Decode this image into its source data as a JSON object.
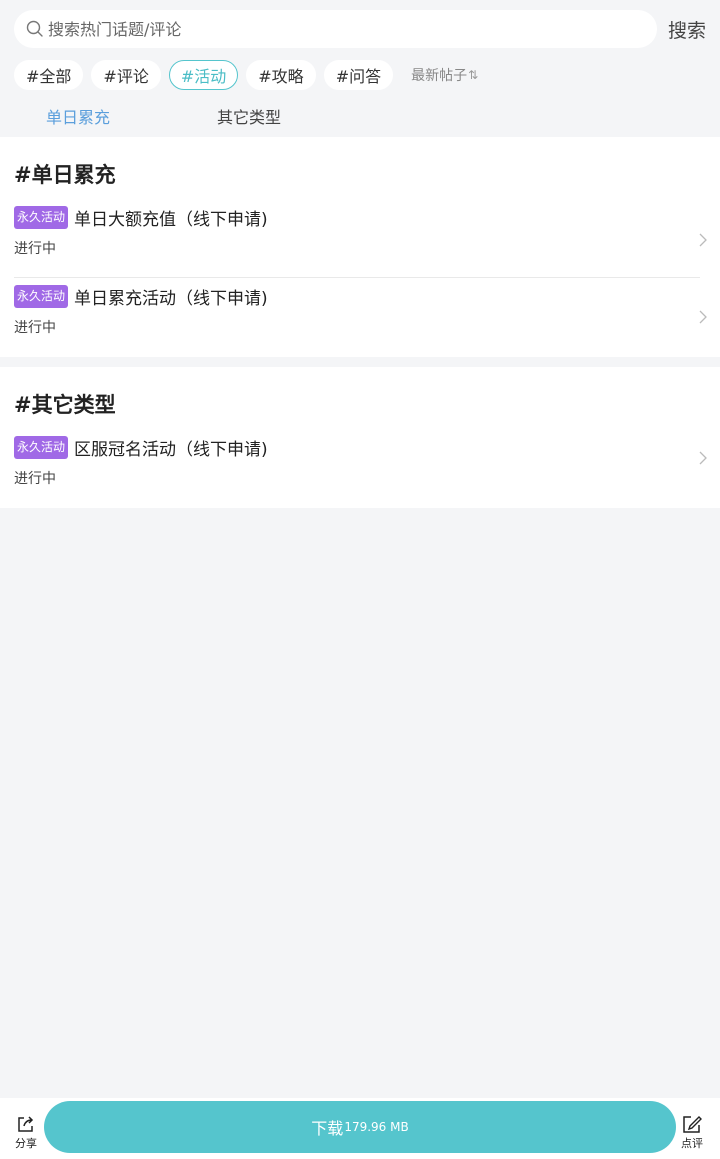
{
  "search": {
    "placeholder": "搜索热门话题/评论",
    "button_label": "搜索"
  },
  "tags": [
    {
      "label": "#全部",
      "active": false
    },
    {
      "label": "#评论",
      "active": false
    },
    {
      "label": "#活动",
      "active": true
    },
    {
      "label": "#攻略",
      "active": false
    },
    {
      "label": "#问答",
      "active": false
    }
  ],
  "sort": {
    "label": "最新帖子",
    "icon": "sort-icon"
  },
  "subtabs": [
    {
      "label": "单日累充",
      "active": true
    },
    {
      "label": "其它类型",
      "active": false
    }
  ],
  "sections": [
    {
      "title": "#单日累充",
      "items": [
        {
          "badge": "永久活动",
          "title": "单日大额充值（线下申请)",
          "status": "进行中"
        },
        {
          "badge": "永久活动",
          "title": "单日累充活动（线下申请)",
          "status": "进行中"
        }
      ]
    },
    {
      "title": "#其它类型",
      "items": [
        {
          "badge": "永久活动",
          "title": "区服冠名活动（线下申请)",
          "status": "进行中"
        }
      ]
    }
  ],
  "bottom_bar": {
    "share_label": "分享",
    "download_label": "下载",
    "download_size": "179.96 MB",
    "review_label": "点评"
  },
  "colors": {
    "accent": "#55c5cd",
    "badge": "#a069e6",
    "subtab_active": "#5b9fdc",
    "background": "#f4f5f7"
  }
}
